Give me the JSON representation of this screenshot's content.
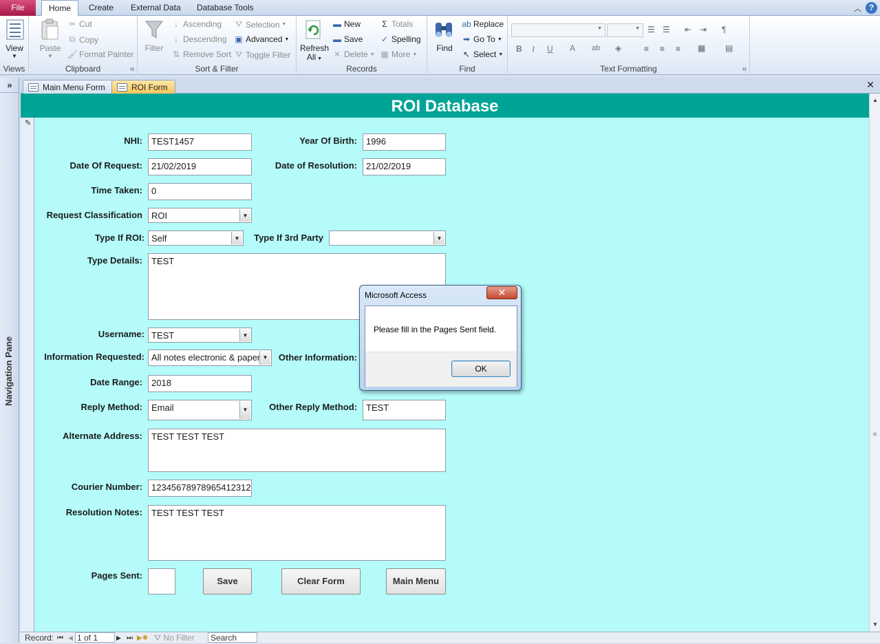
{
  "ribbon_tabs": {
    "file": "File",
    "home": "Home",
    "create": "Create",
    "external_data": "External Data",
    "database_tools": "Database Tools"
  },
  "ribbon": {
    "views": {
      "view": "View",
      "group": "Views"
    },
    "clipboard": {
      "paste": "Paste",
      "cut": "Cut",
      "copy": "Copy",
      "format_painter": "Format Painter",
      "group": "Clipboard"
    },
    "sort_filter": {
      "filter": "Filter",
      "ascending": "Ascending",
      "descending": "Descending",
      "remove_sort": "Remove Sort",
      "selection": "Selection",
      "advanced": "Advanced",
      "toggle_filter": "Toggle Filter",
      "group": "Sort & Filter"
    },
    "records": {
      "refresh": "Refresh",
      "refresh_all": "All",
      "new": "New",
      "save": "Save",
      "delete": "Delete",
      "totals": "Totals",
      "spelling": "Spelling",
      "more": "More",
      "group": "Records"
    },
    "find": {
      "find": "Find",
      "replace": "Replace",
      "go_to": "Go To",
      "select": "Select",
      "group": "Find"
    },
    "text_formatting": {
      "group": "Text Formatting"
    }
  },
  "nav_pane": {
    "label": "Navigation Pane"
  },
  "doc_tabs": [
    {
      "label": "Main Menu Form"
    },
    {
      "label": "ROI Form"
    }
  ],
  "form": {
    "title": "ROI Database",
    "nhi": {
      "label": "NHI:",
      "value": "TEST1457"
    },
    "year_of_birth": {
      "label": "Year Of Birth:",
      "value": "1996"
    },
    "date_of_request": {
      "label": "Date Of Request:",
      "value": "21/02/2019"
    },
    "date_of_resolution": {
      "label": "Date of Resolution:",
      "value": "21/02/2019"
    },
    "time_taken": {
      "label": "Time Taken:",
      "value": "0"
    },
    "request_classification": {
      "label": "Request Classification",
      "value": "ROI"
    },
    "type_if_roi": {
      "label": "Type If ROI:",
      "value": "Self"
    },
    "type_if_3rd_party": {
      "label": "Type If 3rd Party",
      "value": ""
    },
    "type_details": {
      "label": "Type Details:",
      "value": "TEST"
    },
    "username": {
      "label": "Username:",
      "value": "TEST"
    },
    "information_requested": {
      "label": "Information Requested:",
      "value": "All notes electronic & paper"
    },
    "other_information": {
      "label": "Other Information:"
    },
    "date_range": {
      "label": "Date Range:",
      "value": "2018"
    },
    "reply_method": {
      "label": "Reply Method:",
      "value": "Email"
    },
    "other_reply_method": {
      "label": "Other Reply Method:",
      "value": "TEST"
    },
    "alternate_address": {
      "label": "Alternate Address:",
      "value": "TEST TEST TEST"
    },
    "courier_number": {
      "label": "Courier Number:",
      "value": "12345678978965412312"
    },
    "resolution_notes": {
      "label": "Resolution Notes:",
      "value": "TEST TEST TEST"
    },
    "pages_sent": {
      "label": "Pages Sent:",
      "value": ""
    },
    "buttons": {
      "save": "Save",
      "clear": "Clear Form",
      "main_menu": "Main Menu"
    }
  },
  "record_nav": {
    "record_label": "Record:",
    "position": "1 of 1",
    "filter": "No Filter",
    "search": "Search"
  },
  "dialog": {
    "title": "Microsoft Access",
    "message": "Please fill in the Pages Sent field.",
    "ok": "OK"
  }
}
